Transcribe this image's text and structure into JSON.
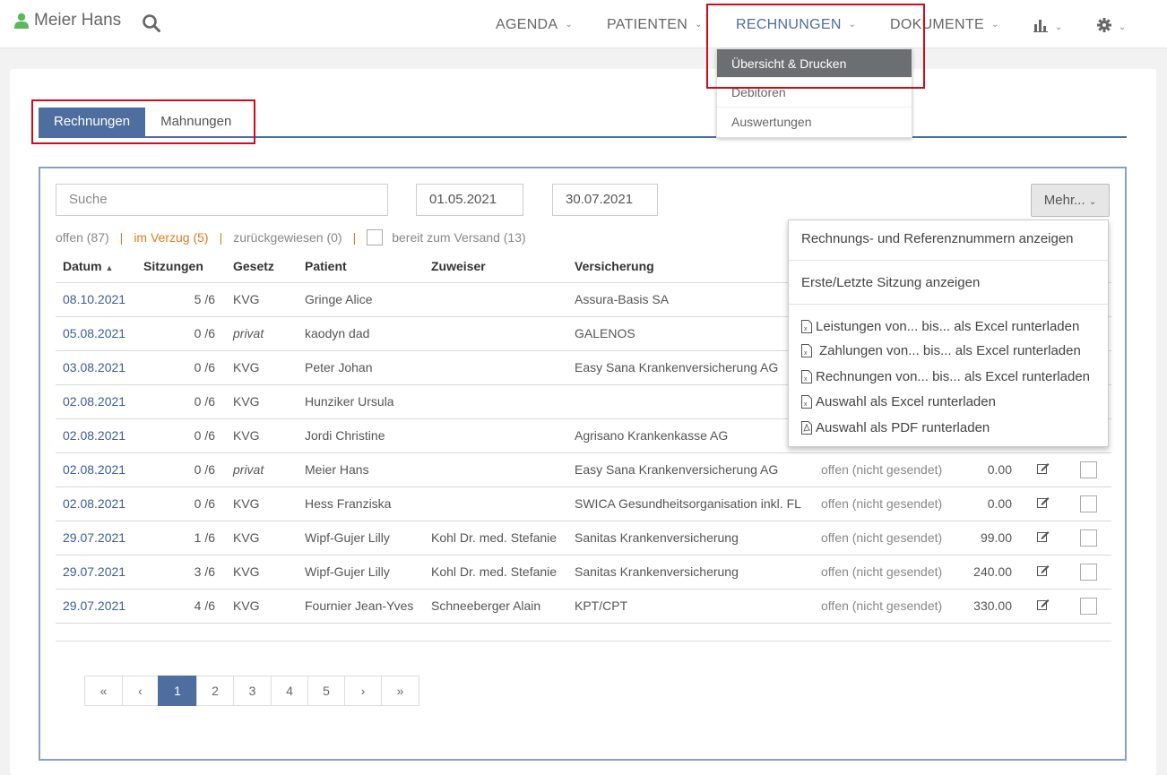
{
  "user": {
    "name": "Meier Hans"
  },
  "nav": {
    "agenda": "AGENDA",
    "patienten": "PATIENTEN",
    "rechnungen": "RECHNUNGEN",
    "dokumente": "DOKUMENTE",
    "chevron": "⌄",
    "dropdown": [
      "Übersicht & Drucken",
      "Debitoren",
      "Auswertungen"
    ]
  },
  "tabs": [
    "Rechnungen",
    "Mahnungen"
  ],
  "filters": {
    "search_placeholder": "Suche",
    "date_from": "01.05.2021",
    "date_to": "30.07.2021",
    "mehr": "Mehr...",
    "offen": "offen (87)",
    "verzug": "im Verzug (5)",
    "zurueck": "zurückgewiesen (0)",
    "bereit": "bereit zum Versand (13)",
    "sep": "|"
  },
  "table": {
    "headers": [
      "Datum",
      "Sitzungen",
      "Gesetz",
      "Patient",
      "Zuweiser",
      "Versicherung"
    ],
    "sort_arrow": "▲",
    "rows": [
      {
        "date": "08.10.2021",
        "sessions": "5 /6",
        "law": "KVG",
        "patient": "Gringe Alice",
        "referrer": "",
        "insurance": "Assura-Basis SA",
        "status": "",
        "amount": ""
      },
      {
        "date": "05.08.2021",
        "sessions": "0 /6",
        "law": "privat",
        "patient": "kaodyn dad",
        "referrer": "",
        "insurance": "GALENOS",
        "status": "",
        "amount": ""
      },
      {
        "date": "03.08.2021",
        "sessions": "0 /6",
        "law": "KVG",
        "patient": "Peter Johan",
        "referrer": "",
        "insurance": "Easy Sana Krankenversicherung AG",
        "status": "",
        "amount": ""
      },
      {
        "date": "02.08.2021",
        "sessions": "0 /6",
        "law": "KVG",
        "patient": "Hunziker Ursula",
        "referrer": "",
        "insurance": "",
        "status": "",
        "amount": ""
      },
      {
        "date": "02.08.2021",
        "sessions": "0 /6",
        "law": "KVG",
        "patient": "Jordi Christine",
        "referrer": "",
        "insurance": "Agrisano Krankenkasse AG",
        "status": "",
        "amount": ""
      },
      {
        "date": "02.08.2021",
        "sessions": "0 /6",
        "law": "privat",
        "patient": "Meier Hans",
        "referrer": "",
        "insurance": "Easy Sana Krankenversicherung AG",
        "status": "offen (nicht gesendet)",
        "amount": "0.00"
      },
      {
        "date": "02.08.2021",
        "sessions": "0 /6",
        "law": "KVG",
        "patient": "Hess Franziska",
        "referrer": "",
        "insurance": "SWICA Gesundheitsorganisation inkl. FL",
        "status": "offen (nicht gesendet)",
        "amount": "0.00"
      },
      {
        "date": "29.07.2021",
        "sessions": "1 /6",
        "law": "KVG",
        "patient": "Wipf-Gujer Lilly",
        "referrer": "Kohl Dr. med. Stefanie",
        "insurance": "Sanitas Krankenversicherung",
        "status": "offen (nicht gesendet)",
        "amount": "99.00"
      },
      {
        "date": "29.07.2021",
        "sessions": "3 /6",
        "law": "KVG",
        "patient": "Wipf-Gujer Lilly",
        "referrer": "Kohl Dr. med. Stefanie",
        "insurance": "Sanitas Krankenversicherung",
        "status": "offen (nicht gesendet)",
        "amount": "240.00"
      },
      {
        "date": "29.07.2021",
        "sessions": "4 /6",
        "law": "KVG",
        "patient": "Fournier Jean-Yves",
        "referrer": "Schneeberger Alain",
        "insurance": "KPT/CPT",
        "status": "offen (nicht gesendet)",
        "amount": "330.00"
      }
    ]
  },
  "pager": [
    "«",
    "‹",
    "1",
    "2",
    "3",
    "4",
    "5",
    "›",
    "»"
  ],
  "mehr_menu": [
    "Rechnungs- und Referenznummern anzeigen",
    "Erste/Letzte Sitzung anzeigen",
    "Leistungen von... bis... als Excel runterladen",
    "Zahlungen von... bis... als Excel runterladen",
    "Rechnungen von... bis... als Excel runterladen",
    "Auswahl als Excel runterladen",
    "Auswahl als PDF runterladen"
  ],
  "colors": {
    "accent": "#4e6ea0",
    "highlight": "#d2091d",
    "warning": "#e07b1f",
    "user_icon": "#5cb85c"
  }
}
